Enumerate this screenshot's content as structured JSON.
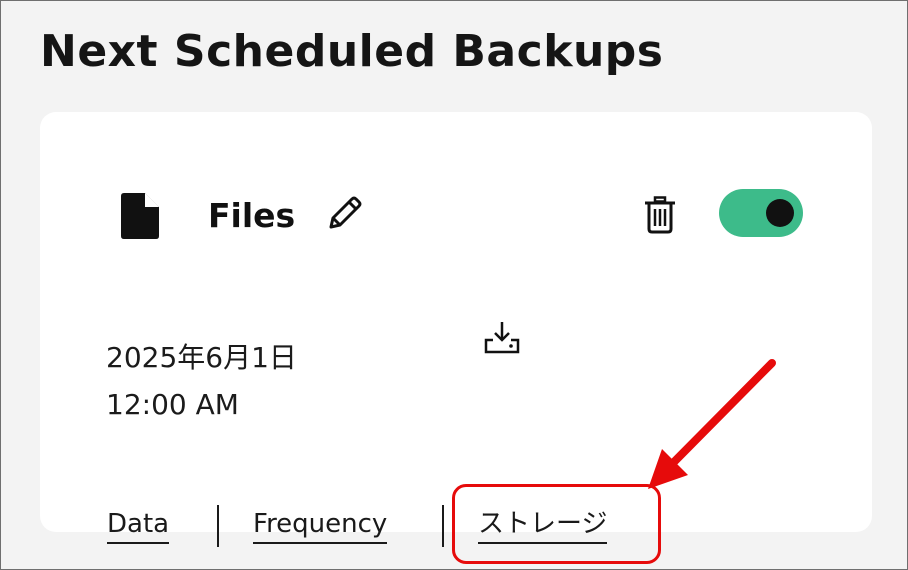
{
  "header": {
    "title": "Next Scheduled Backups"
  },
  "backup": {
    "name": "Files",
    "date": "2025年6月1日",
    "time": "12:00 AM",
    "enabled": true
  },
  "tabs": [
    {
      "label": "Data"
    },
    {
      "label": "Frequency"
    },
    {
      "label": "ストレージ"
    }
  ],
  "colors": {
    "toggle_on": "#3dbb8a",
    "highlight": "#e60b0b"
  },
  "icons": [
    "file-icon",
    "pencil-icon",
    "trash-icon",
    "download-icon"
  ]
}
